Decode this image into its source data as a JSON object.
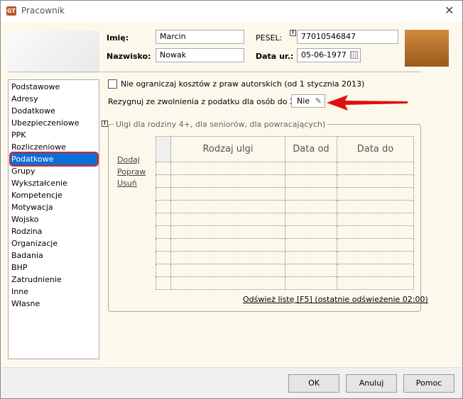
{
  "window": {
    "title": "Pracownik",
    "close_icon": "close-icon",
    "app_icon_text": "GT"
  },
  "header": {
    "imie_label": "Imię:",
    "imie_value": "Marcin",
    "nazwisko_label": "Nazwisko:",
    "nazwisko_value": "Nowak",
    "pesel_label": "PESEL:",
    "pesel_value": "77010546847",
    "data_label": "Data ur.:",
    "data_value": "05-06-1977"
  },
  "sidebar": {
    "items": [
      "Podstawowe",
      "Adresy",
      "Dodatkowe",
      "Ubezpieczeniowe",
      "PPK",
      "Rozliczeniowe",
      "Podatkowe",
      "Grupy",
      "Wykształcenie",
      "Kompetencje",
      "Motywacja",
      "Wojsko",
      "Rodzina",
      "Organizacje",
      "Badania",
      "BHP",
      "Zatrudnienie",
      "Inne",
      "Własne"
    ],
    "selected": "Podatkowe"
  },
  "main": {
    "checkbox_label": "Nie ograniczaj kosztów z praw autorskich (od 1 stycznia 2013)",
    "checkbox_checked": false,
    "rezygnuj_label": "Rezygnuj ze zwolnienia z podatku dla osób do 26 lat:",
    "rezygnuj_value": "Nie",
    "group_title": "Ulgi dla rodziny 4+, dla seniorów, dla powracających)",
    "actions": [
      "Dodaj",
      "Popraw",
      "Usuń"
    ],
    "columns": [
      "Rodzaj ulgi",
      "Data od",
      "Data do"
    ],
    "refresh_link": "Odśwież listę [F5] (ostatnie odświeżenie 02:00)",
    "arrow_color": "#e01010"
  },
  "footer": {
    "ok": "OK",
    "cancel": "Anuluj",
    "help": "Pomoc"
  }
}
